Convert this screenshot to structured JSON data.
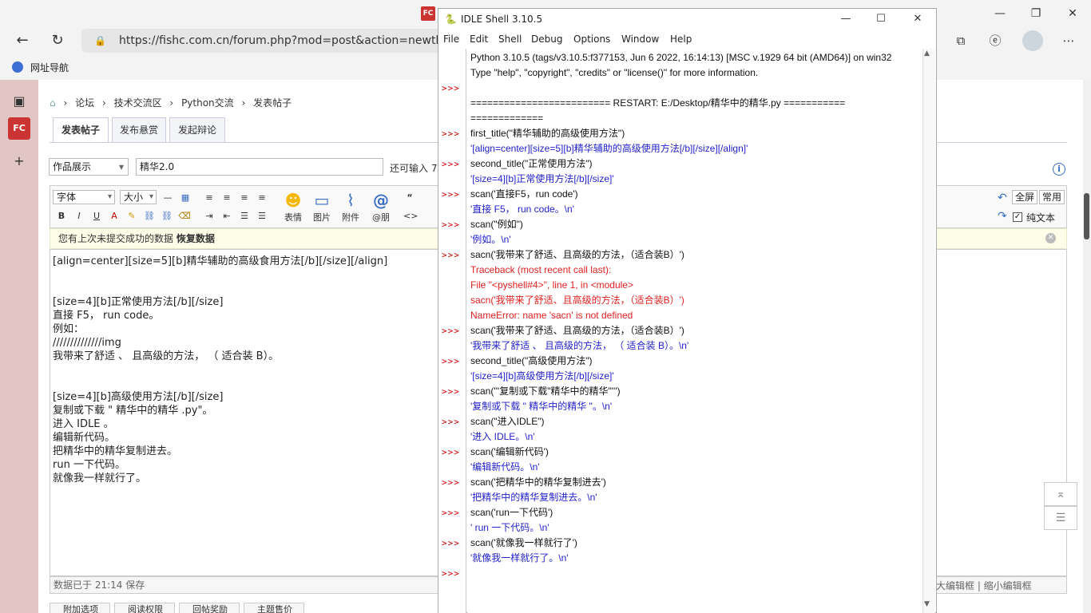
{
  "browser": {
    "tab_icon": "FC",
    "url": "https://fishc.com.cn/forum.php?mod=post&action=newthread&",
    "bookmark": "网址导航",
    "icons": [
      "back-icon",
      "refresh-icon",
      "lock-icon",
      "collections-icon",
      "edge-icon",
      "profile-avatar",
      "more-icon"
    ]
  },
  "sidebar": {
    "fc_label": "FC"
  },
  "breadcrumb": [
    "论坛",
    "技术交流区",
    "Python交流",
    "发表帖子"
  ],
  "tabs": [
    "发表帖子",
    "发布悬赏",
    "发起辩论"
  ],
  "form": {
    "category": "作品展示",
    "title_value": "精华2.0",
    "remain_label": "还可输入 7"
  },
  "toolbar": {
    "font": "字体",
    "size": "大小",
    "emoji": "表情",
    "image": "图片",
    "attach": "附件",
    "at": "@朋",
    "fullscreen": "全屏",
    "common": "常用",
    "plaintext": "纯文本"
  },
  "restore": {
    "text": "您有上次未提交成功的数据 ",
    "link": "恢复数据"
  },
  "editor_lines": [
    "[align=center][size=5][b]精华辅助的高级食用方法[/b][/size][/align]",
    "",
    "",
    "[size=4][b]正常使用方法[/b][/size]",
    "直接 F5， run code。",
    "例如：",
    "//////////////img",
    "我带来了舒适 、 且高级的方法， （ 适合装 B）。",
    "",
    "",
    "[size=4][b]高级使用方法[/b][/size]",
    "复制或下载 \" 精华中的精华  .py\"。",
    "进入 IDLE 。",
    "编辑新代码。",
    "把精华中的精华复制进去。",
    "run 一下代码。",
    "就像我一样就行了。"
  ],
  "status": {
    "saved": "数据已于 21:14 保存",
    "right": "加大编辑框 | 缩小编辑框"
  },
  "bottom_tabs": [
    "附加选项",
    "阅读权限",
    "回帖奖励",
    "主题售价"
  ],
  "idle": {
    "title": "IDLE Shell 3.10.5",
    "menu": [
      "File",
      "Edit",
      "Shell",
      "Debug",
      "Options",
      "Window",
      "Help"
    ],
    "prompt": ">>>",
    "lines": [
      {
        "t": "Python 3.10.5 (tags/v3.10.5:f377153, Jun  6 2022, 16:14:13) [MSC v.1929 64 bit (AMD64)] on win32",
        "c": "std",
        "p": false
      },
      {
        "t": "Type \"help\", \"copyright\", \"credits\" or \"license()\" for more information.",
        "c": "std",
        "p": false
      },
      {
        "t": "",
        "c": "std",
        "p": true
      },
      {
        "t": "========================= RESTART: E:/Desktop/精华中的精华.py ===========",
        "c": "std",
        "p": false
      },
      {
        "t": "=============",
        "c": "std",
        "p": false
      },
      {
        "t": "first_title(\"精华辅助的高级使用方法\")",
        "c": "std",
        "p": true
      },
      {
        "t": "'[align=center][size=5][b]精华辅助的高级使用方法[/b][/size][/align]'",
        "c": "out",
        "p": false
      },
      {
        "t": "second_title(\"正常使用方法\")",
        "c": "std",
        "p": true
      },
      {
        "t": "'[size=4][b]正常使用方法[/b][/size]'",
        "c": "out",
        "p": false
      },
      {
        "t": "scan('直接F5，run code')",
        "c": "std",
        "p": true
      },
      {
        "t": "'直接 F5，  run code。\\n'",
        "c": "out",
        "p": false
      },
      {
        "t": "scan(\"例如\")",
        "c": "std",
        "p": true
      },
      {
        "t": "'例如。\\n'",
        "c": "out",
        "p": false
      },
      {
        "t": "sacn('我带来了舒适、且高级的方法，（适合装B）')",
        "c": "std",
        "p": true
      },
      {
        "t": "Traceback (most recent call last):",
        "c": "err",
        "p": false
      },
      {
        "t": "  File \"<pyshell#4>\", line 1, in <module>",
        "c": "err",
        "p": false
      },
      {
        "t": "    sacn('我带来了舒适、且高级的方法，（适合装B）')",
        "c": "err",
        "p": false
      },
      {
        "t": "NameError: name 'sacn' is not defined",
        "c": "err",
        "p": false
      },
      {
        "t": "scan('我带来了舒适、且高级的方法，（适合装B）')",
        "c": "std",
        "p": true
      },
      {
        "t": "'我带来了舒适 、 且高级的方法，  （ 适合装 B）。\\n'",
        "c": "out",
        "p": false
      },
      {
        "t": "second_title(\"高级使用方法\")",
        "c": "std",
        "p": true
      },
      {
        "t": "'[size=4][b]高级使用方法[/b][/size]'",
        "c": "out",
        "p": false
      },
      {
        "t": "scan('''复制或下载\"精华中的精华\"''')",
        "c": "std",
        "p": true
      },
      {
        "t": "'复制或下载 \" 精华中的精华 \"。\\n'",
        "c": "out",
        "p": false
      },
      {
        "t": "scan(\"进入IDLE\")",
        "c": "std",
        "p": true
      },
      {
        "t": "'进入 IDLE。\\n'",
        "c": "out",
        "p": false
      },
      {
        "t": "scan('编辑新代码')",
        "c": "std",
        "p": true
      },
      {
        "t": "'编辑新代码。\\n'",
        "c": "out",
        "p": false
      },
      {
        "t": "scan('把精华中的精华复制进去')",
        "c": "std",
        "p": true
      },
      {
        "t": "'把精华中的精华复制进去。\\n'",
        "c": "out",
        "p": false
      },
      {
        "t": "scan('run一下代码')",
        "c": "std",
        "p": true
      },
      {
        "t": "' run 一下代码。\\n'",
        "c": "out",
        "p": false
      },
      {
        "t": "scan('就像我一样就行了')",
        "c": "std",
        "p": true
      },
      {
        "t": "'就像我一样就行了。\\n'",
        "c": "out",
        "p": false
      },
      {
        "t": "",
        "c": "std",
        "p": true
      }
    ]
  }
}
